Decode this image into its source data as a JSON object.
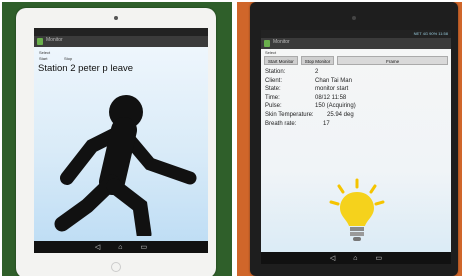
{
  "photos": [
    {
      "device": {
        "app_title": "Monitor",
        "select_label": "Select",
        "tab_labels": [
          "Start",
          "Stop"
        ],
        "heading": "Station 2 peter p leave",
        "figure": "walking-person-icon",
        "nav_icons": [
          "back-icon",
          "home-icon",
          "recent-apps-icon"
        ]
      }
    },
    {
      "device": {
        "app_title": "Monitor",
        "status_text": "NET 4G 90% 11:58",
        "select_label": "Select",
        "buttons": [
          "Start Monitor",
          "Stop Monitor",
          "Frame"
        ],
        "fields": [
          {
            "label": "Station:",
            "value": "2"
          },
          {
            "label": "Client:",
            "value": "Chan Tai Man"
          },
          {
            "label": "State:",
            "value": "monitor start"
          },
          {
            "label": "Time:",
            "value": "08/12 11:58"
          },
          {
            "label": "Pulse:",
            "value": "150 (Acquiring)"
          },
          {
            "label": "Skin Temperature:",
            "value": "25.94 deg"
          },
          {
            "label": "Breath rate:",
            "value": "17"
          }
        ],
        "figure": "light-bulb-icon",
        "nav_icons": [
          "back-icon",
          "home-icon",
          "recent-apps-icon"
        ]
      }
    }
  ],
  "colors": {
    "left_background": "#2f5f2a",
    "right_background": "#d0662a",
    "bulb_yellow": "#f5d21c"
  }
}
